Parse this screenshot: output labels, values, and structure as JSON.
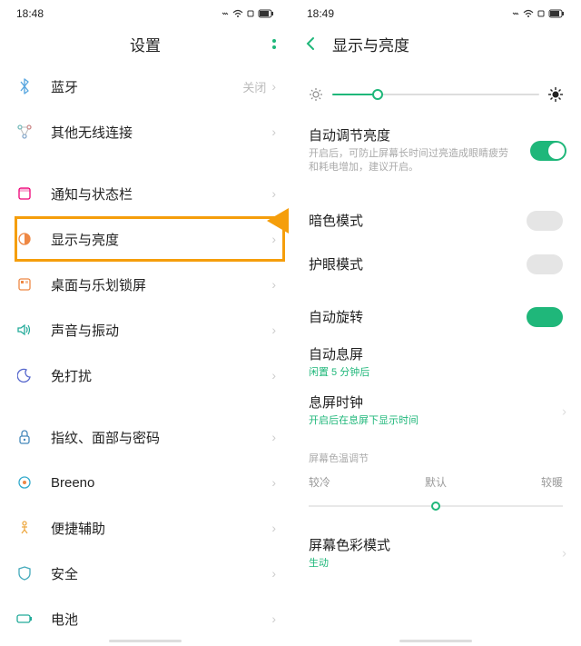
{
  "left": {
    "status_time": "18:48",
    "header_title": "设置",
    "items": [
      {
        "label": "蓝牙",
        "right": "关闭"
      },
      {
        "label": "其他无线连接"
      },
      {
        "label": "通知与状态栏"
      },
      {
        "label": "显示与亮度"
      },
      {
        "label": "桌面与乐划锁屏"
      },
      {
        "label": "声音与振动"
      },
      {
        "label": "免打扰"
      },
      {
        "label": "指纹、面部与密码"
      },
      {
        "label": "Breeno"
      },
      {
        "label": "便捷辅助"
      },
      {
        "label": "安全"
      },
      {
        "label": "电池"
      }
    ]
  },
  "right": {
    "status_time": "18:49",
    "header_title": "显示与亮度",
    "brightness_pct": 22,
    "auto_brightness": {
      "title": "自动调节亮度",
      "sub": "开启后，可防止屏幕长时间过亮造成眼睛疲劳和耗电增加，建议开启。",
      "on": true
    },
    "dark_mode": {
      "label": "暗色模式",
      "on": false
    },
    "eye_care": {
      "label": "护眼模式",
      "on": false
    },
    "auto_rotate": {
      "label": "自动旋转",
      "on": true
    },
    "auto_sleep": {
      "title": "自动息屏",
      "sub": "闲置 5 分钟后"
    },
    "aod_clock": {
      "title": "息屏时钟",
      "sub": "开启后在息屏下显示时间"
    },
    "temp_section": "屏幕色温调节",
    "temp_labels": {
      "cold": "较冷",
      "default": "默认",
      "warm": "较暖"
    },
    "temp_pct": 50,
    "color_mode": {
      "title": "屏幕色彩模式",
      "sub": "生动"
    }
  },
  "colors": {
    "accent": "#1fb77a",
    "highlight": "#f59e0b"
  }
}
